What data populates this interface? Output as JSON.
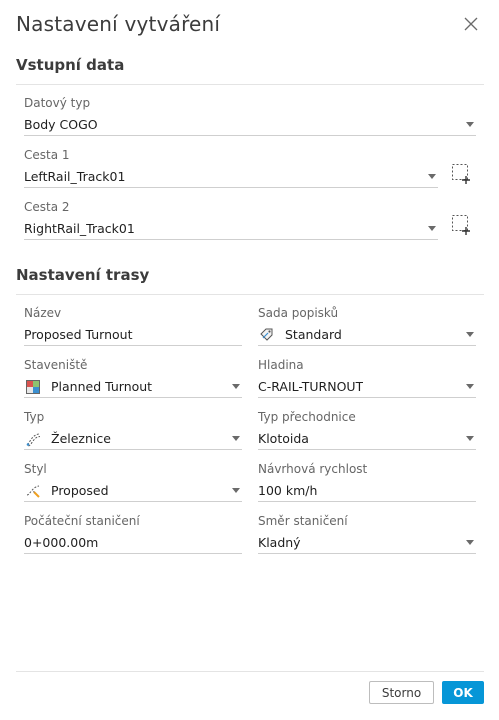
{
  "dialog": {
    "title": "Nastavení vytváření"
  },
  "input_section": {
    "title": "Vstupní data",
    "data_type": {
      "label": "Datový typ",
      "value": "Body COGO"
    },
    "path1": {
      "label": "Cesta 1",
      "value": "LeftRail_Track01"
    },
    "path2": {
      "label": "Cesta 2",
      "value": "RightRail_Track01"
    }
  },
  "alignment_section": {
    "title": "Nastavení trasy",
    "name": {
      "label": "Název",
      "value": "Proposed Turnout"
    },
    "label_set": {
      "label": "Sada popisků",
      "value": "Standard",
      "icon": "label-set-icon"
    },
    "site": {
      "label": "Staveniště",
      "value": "Planned Turnout",
      "icon": "site-icon"
    },
    "layer": {
      "label": "Hladina",
      "value": "C-RAIL-TURNOUT"
    },
    "type": {
      "label": "Typ",
      "value": "Železnice",
      "icon": "railway-type-icon"
    },
    "transition_type": {
      "label": "Typ přechodnice",
      "value": "Klotoida"
    },
    "style": {
      "label": "Styl",
      "value": "Proposed",
      "icon": "alignment-style-icon"
    },
    "design_speed": {
      "label": "Návrhová rychlost",
      "value": "100 km/h"
    },
    "start_station": {
      "label": "Počáteční staničení",
      "value": "0+000.00m"
    },
    "station_direction": {
      "label": "Směr staničení",
      "value": "Kladný"
    }
  },
  "footer": {
    "cancel_label": "Storno",
    "ok_label": "OK"
  },
  "colors": {
    "accent": "#0696d7",
    "text": "#3c3c3c",
    "label": "#666666"
  }
}
